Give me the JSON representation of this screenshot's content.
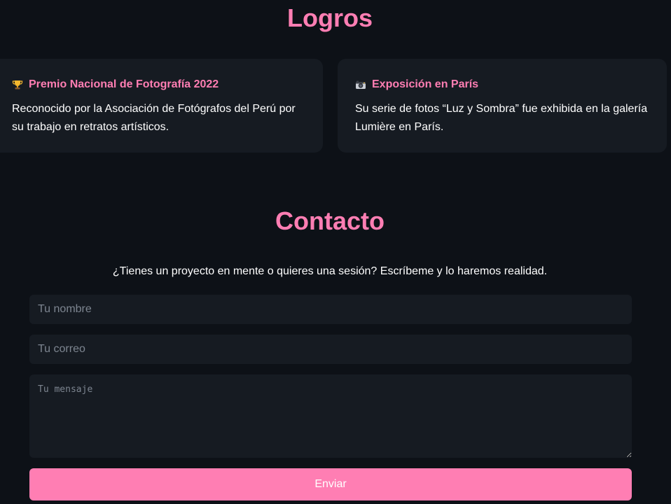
{
  "logros": {
    "title": "Logros",
    "cards": [
      {
        "icon": "trophy-icon",
        "title": "Premio Nacional de Fotografía 2022",
        "text": "Reconocido por la Asociación de Fotógrafos del Perú por su trabajo en retratos artísticos."
      },
      {
        "icon": "camera-icon",
        "title": "Exposición en París",
        "text": "Su serie de fotos “Luz y Sombra” fue exhibida en la galería Lumière en París."
      }
    ]
  },
  "contacto": {
    "title": "Contacto",
    "subtitle": "¿Tienes un proyecto en mente o quieres una sesión? Escríbeme y lo haremos realidad.",
    "form": {
      "name_placeholder": "Tu nombre",
      "email_placeholder": "Tu correo",
      "message_placeholder": "Tu mensaje",
      "submit_label": "Enviar"
    }
  },
  "colors": {
    "background": "#0d1117",
    "card": "#161b22",
    "accent": "#ff7eb3",
    "placeholder": "#7d8590"
  }
}
